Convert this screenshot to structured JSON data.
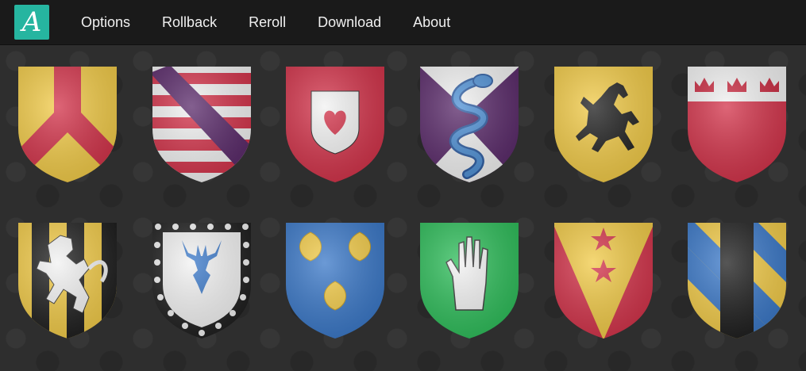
{
  "app": {
    "logo_letter": "A",
    "colors": {
      "accent": "#26b5a0",
      "topbar": "#1a1a1a",
      "background": "#2f2f2f"
    }
  },
  "nav": {
    "options": "Options",
    "rollback": "Rollback",
    "reroll": "Reroll",
    "download": "Download",
    "about": "About"
  },
  "gallery": {
    "shields": [
      {
        "name": "gold-red-pall-shield"
      },
      {
        "name": "argent-gules-bendy-purple-bend-shield"
      },
      {
        "name": "gules-heart-inescutcheon-shield"
      },
      {
        "name": "purple-argent-serpent-shield"
      },
      {
        "name": "gold-black-horse-shield"
      },
      {
        "name": "gules-crowns-chief-shield"
      },
      {
        "name": "gold-black-paly-lion-shield"
      },
      {
        "name": "argent-stag-bordure-shield"
      },
      {
        "name": "azure-three-shells-shield"
      },
      {
        "name": "vert-hand-shield"
      },
      {
        "name": "gold-gules-stars-shield"
      },
      {
        "name": "azure-gold-bendy-black-pale-shield"
      }
    ]
  }
}
